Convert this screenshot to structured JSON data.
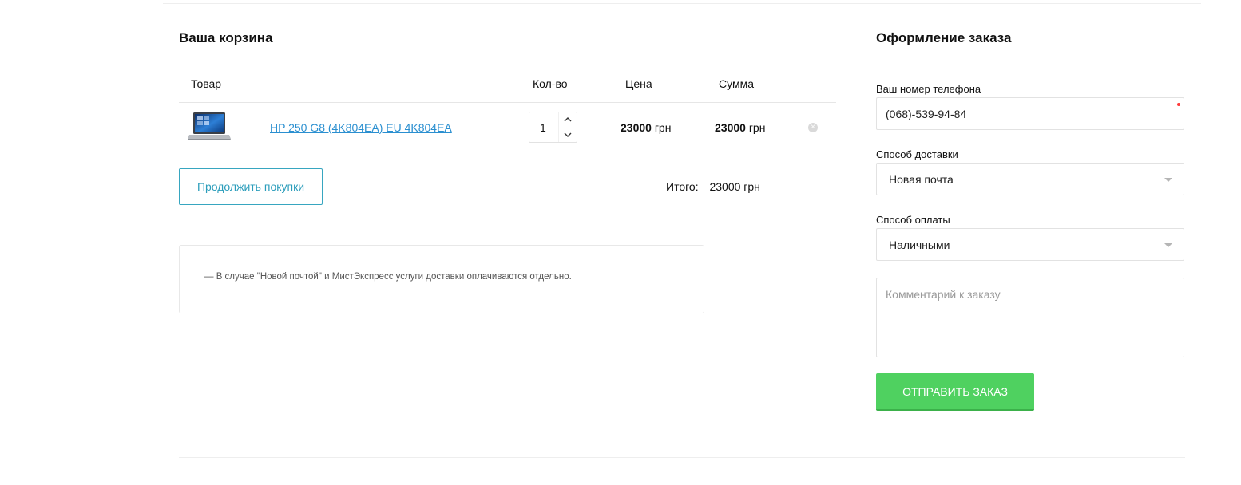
{
  "cart": {
    "title": "Ваша корзина",
    "columns": {
      "product": "Товар",
      "qty": "Кол-во",
      "price": "Цена",
      "sum": "Сумма"
    },
    "items": [
      {
        "name": "HP 250 G8 (4K804EA) EU 4K804EA",
        "qty": "1",
        "price": "23000",
        "sum": "23000",
        "currency": "грн",
        "thumb_icon": "laptop-icon",
        "remove_icon": "close-circle-icon"
      }
    ],
    "continue_label": "Продолжить покупки",
    "total_label": "Итого:",
    "total_value": "23000 грн",
    "note": "— В случае \"Новой почтой\" и МистЭкспресс услуги доставки оплачиваются отдельно."
  },
  "checkout": {
    "title": "Оформление заказа",
    "phone_label": "Ваш номер телефона",
    "phone_value": "(068)-539-94-84",
    "delivery_label": "Способ доставки",
    "delivery_value": "Новая почта",
    "payment_label": "Способ оплаты",
    "payment_value": "Наличными",
    "comment_placeholder": "Комментарий к заказу",
    "submit_label": "ОТПРАВИТЬ ЗАКАЗ"
  },
  "colors": {
    "link": "#2a8fd0",
    "continue_border": "#37a6c0",
    "submit_bg": "#4fd160",
    "required": "#ff3a3a"
  }
}
